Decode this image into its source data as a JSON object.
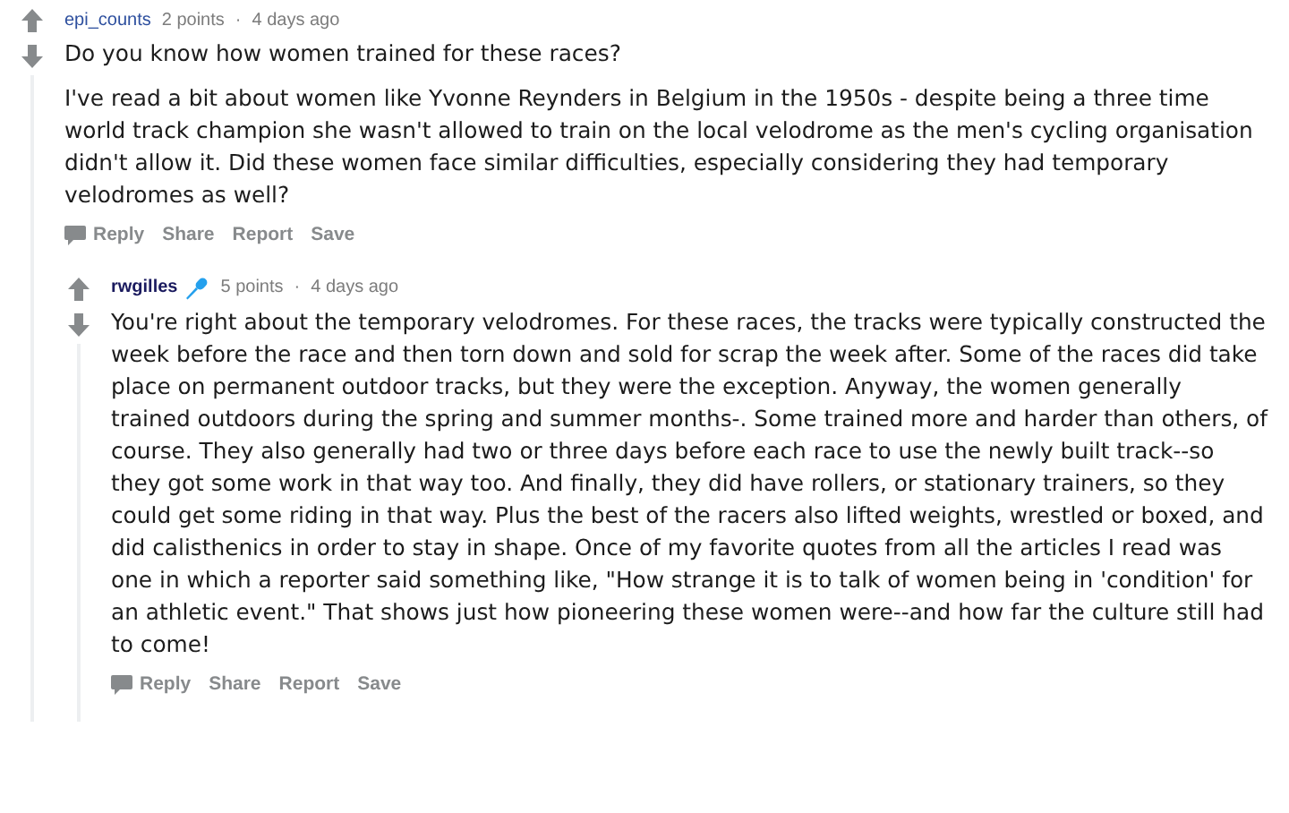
{
  "comments": [
    {
      "author": "epi_counts",
      "author_flair": false,
      "points": "2 points",
      "separator": "·",
      "time": "4 days ago",
      "paragraphs": [
        "Do you know how women trained for these races?",
        "I've read a bit about women like Yvonne Reynders in Belgium in the 1950s - despite being a three time world track champion she wasn't allowed to train on the local velodrome as the men's cycling organisation didn't allow it. Did these women face similar difficulties, especially considering they had temporary velodromes as well?"
      ],
      "actions": [
        "Reply",
        "Share",
        "Report",
        "Save"
      ],
      "children": [
        {
          "author": "rwgilles",
          "author_flair": true,
          "points": "5 points",
          "separator": "·",
          "time": "4 days ago",
          "paragraphs": [
            "You're right about the temporary velodromes. For these races, the tracks were typically constructed the week before the race and then torn down and sold for scrap the week after. Some of the races did take place on permanent outdoor tracks, but they were the exception. Anyway, the women generally trained outdoors during the spring and summer months-. Some trained more and harder than others, of course. They also generally had two or three days before each race to use the newly built track--so they got some work in that way too. And finally, they did have rollers, or stationary trainers, so they could get some riding in that way. Plus the best of the racers also lifted weights, wrestled or boxed, and did calisthenics in order to stay in shape. Once of my favorite quotes from all the articles I read was one in which a reporter said something like, \"How strange it is to talk of women being in 'condition' for an athletic event.\" That shows just how pioneering these women were--and how far the culture still had to come!"
          ],
          "actions": [
            "Reply",
            "Share",
            "Report",
            "Save"
          ]
        }
      ]
    }
  ]
}
